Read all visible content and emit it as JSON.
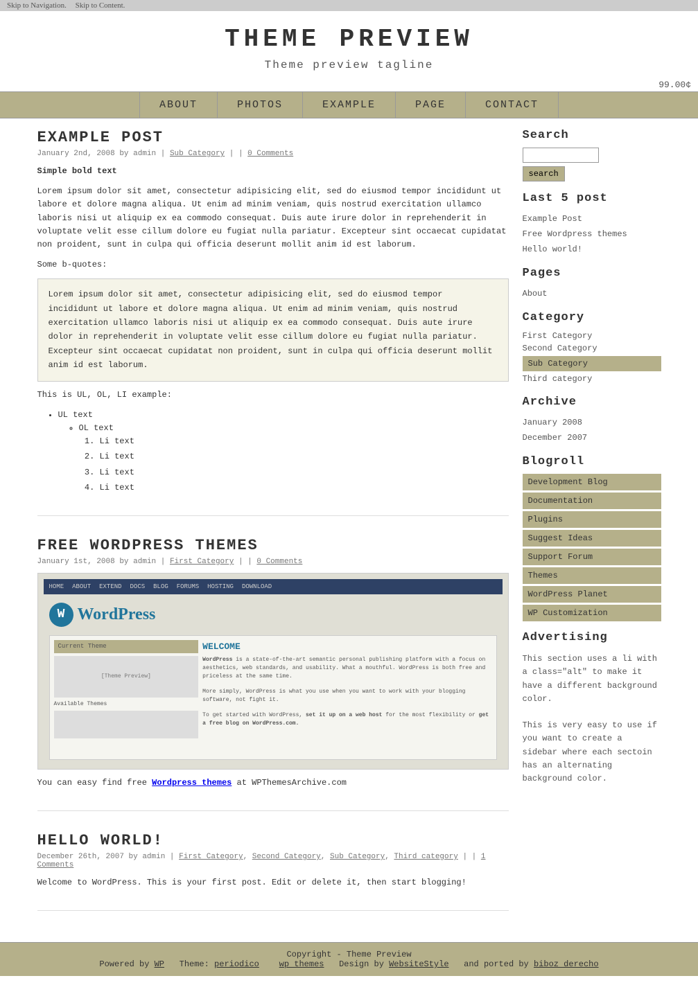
{
  "skip": {
    "nav": "Skip to Navigation.",
    "content": "Skip to Content."
  },
  "header": {
    "title": "THEME PREVIEW",
    "tagline": "Theme preview tagline",
    "price": "99.00¢"
  },
  "nav": {
    "items": [
      {
        "label": "ABOUT",
        "href": "#"
      },
      {
        "label": "PHOTOS",
        "href": "#"
      },
      {
        "label": "EXAMPLE",
        "href": "#"
      },
      {
        "label": "PAGE",
        "href": "#"
      },
      {
        "label": "CONTACT",
        "href": "#"
      }
    ]
  },
  "posts": [
    {
      "id": "example-post",
      "title": "EXAMPLE POST",
      "meta": "January 2nd, 2008 by admin | Sub Category | | 0 Comments",
      "meta_sub_category": "Sub Category",
      "meta_comments": "0 Comments",
      "bold_text": "Simple bold text",
      "paragraph1": "Lorem ipsum dolor sit amet, consectetur adipisicing elit, sed do eiusmod tempor incididunt ut labore et dolore magna aliqua. Ut enim ad minim veniam, quis nostrud exercitation ullamco laboris nisi ut aliquip ex ea commodo consequat. Duis aute irure dolor in reprehenderit in voluptate velit esse cillum dolore eu fugiat nulla pariatur. Excepteur sint occaecat cupidatat non proident, sunt in culpa qui officia deserunt mollit anim id est laborum.",
      "bquote_label": "Some b-quotes:",
      "blockquote": "Lorem ipsum dolor sit amet, consectetur adipisicing elit, sed do eiusmod tempor incididunt ut labore et dolore magna aliqua. Ut enim ad minim veniam, quis nostrud exercitation ullamco laboris nisi ut aliquip ex ea commodo consequat. Duis aute irure dolor in reprehenderit in voluptate velit esse cillum dolore eu fugiat nulla pariatur. Excepteur sint occaecat cupidatat non proident, sunt in culpa qui officia deserunt mollit anim id est laborum.",
      "list_intro": "This is UL, OL, LI example:",
      "ul_items": [
        "UL text",
        "OL text"
      ],
      "ol_items": [
        "Li text",
        "Li text",
        "Li text",
        "Li text"
      ]
    },
    {
      "id": "free-wordpress",
      "title": "FREE WORDPRESS THEMES",
      "meta": "January 1st, 2008 by admin | First Category | | 0 Comments",
      "meta_first_category": "First Category",
      "meta_comments": "0 Comments",
      "wp_logo": "W",
      "wp_brand": "WordPress",
      "paragraph1": "You can easy find free Wordpress themes at WPThemesArchive.com"
    },
    {
      "id": "hello-world",
      "title": "HELLO WORLD!",
      "meta_date": "December 26th, 2007 by admin |",
      "meta_categories": "First Category, Second Category, Sub Category, Third category",
      "meta_comments": "1 Comments",
      "paragraph1": "Welcome to WordPress. This is your first post. Edit or delete it, then start blogging!"
    }
  ],
  "sidebar": {
    "search_label": "Search",
    "search_placeholder": "",
    "search_button": "search",
    "last5_label": "Last 5 post",
    "last5_items": [
      {
        "label": "Example Post"
      },
      {
        "label": "Free Wordpress themes"
      },
      {
        "label": "Hello world!"
      }
    ],
    "pages_label": "Pages",
    "pages_items": [
      {
        "label": "About"
      }
    ],
    "category_label": "Category",
    "categories": [
      {
        "label": "First Category",
        "sub": false
      },
      {
        "label": "Second Category",
        "sub": false
      },
      {
        "label": "Sub Category",
        "sub": true
      },
      {
        "label": "Third category",
        "sub": false
      }
    ],
    "archive_label": "Archive",
    "archive_items": [
      {
        "label": "January 2008"
      },
      {
        "label": "December 2007"
      }
    ],
    "blogroll_label": "Blogroll",
    "blogroll_items": [
      {
        "label": "Development Blog"
      },
      {
        "label": "Documentation"
      },
      {
        "label": "Plugins"
      },
      {
        "label": "Suggest Ideas"
      },
      {
        "label": "Support Forum"
      },
      {
        "label": "Themes"
      },
      {
        "label": "WordPress Planet"
      },
      {
        "label": "WP Customization"
      }
    ],
    "advertising_label": "Advertising",
    "advertising_text1": "This section uses a li with a class=\"alt\" to make it have a different background color.",
    "advertising_text2": "This is very easy to use if you want to create a sidebar where each sectoin has an alternating background color."
  },
  "footer": {
    "copyright": "Copyright - Theme Preview",
    "powered_by": "Powered by",
    "wp_label": "WP",
    "theme_label": "Theme:",
    "theme_name": "periodico",
    "wp_themes": "wp themes",
    "design_label": "Design by",
    "designer": "WebsiteStyle",
    "ported_label": "and ported by",
    "porter": "biboz derecho"
  }
}
